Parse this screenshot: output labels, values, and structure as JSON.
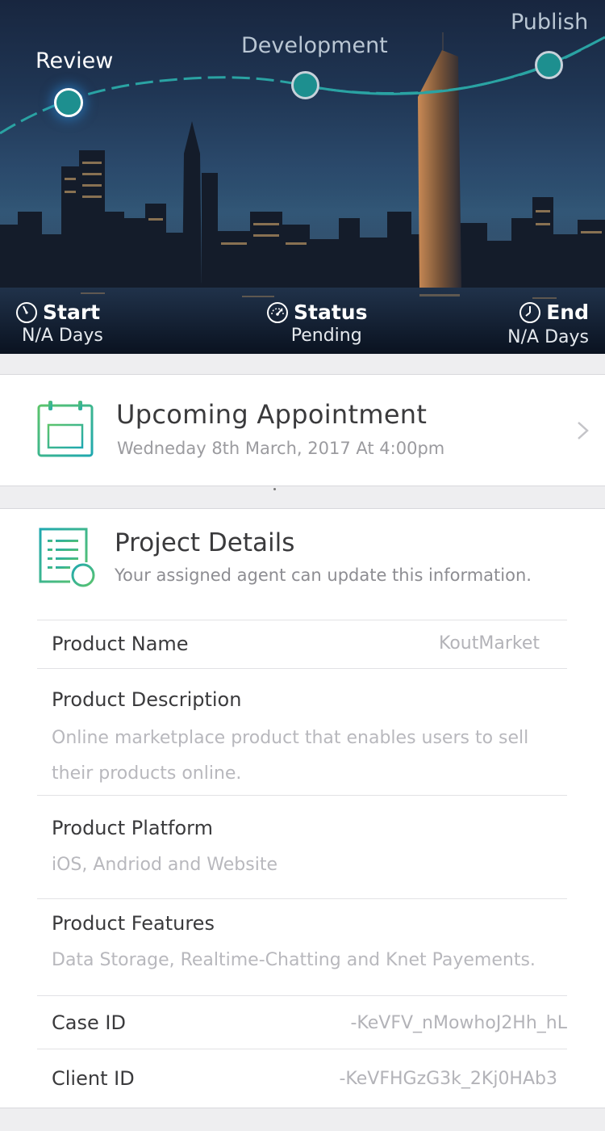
{
  "progress": {
    "stages": [
      {
        "label": "Review",
        "state": "current"
      },
      {
        "label": "Development",
        "state": "upcoming"
      },
      {
        "label": "Publish",
        "state": "upcoming"
      }
    ],
    "colors": {
      "node_fill": "#1d8f8f",
      "current_outline": "#ffffff",
      "path": "#2aa3a3"
    }
  },
  "hero_stats": {
    "start": {
      "label": "Start",
      "value": "N/A Days",
      "icon": "stopwatch-icon"
    },
    "status": {
      "label": "Status",
      "value": "Pending",
      "icon": "speedometer-icon"
    },
    "end": {
      "label": "End",
      "value": "N/A Days",
      "icon": "clock-icon"
    }
  },
  "appointment": {
    "title": "Upcoming Appointment",
    "date": "Wedneday 8th March, 2017 At 4:00pm",
    "icon": "calendar-icon"
  },
  "project_details": {
    "title": "Project Details",
    "subtitle": "Your assigned agent can update this information.",
    "icon": "document-add-icon",
    "fields": {
      "product_name": {
        "label": "Product Name",
        "value": "KoutMarket"
      },
      "product_description": {
        "label": "Product Description",
        "value": "Online marketplace product that enables users to sell their products online."
      },
      "product_platform": {
        "label": "Product Platform",
        "value": "iOS, Andriod and Website"
      },
      "product_features": {
        "label": "Product Features",
        "value": "Data Storage, Realtime-Chatting and Knet Payements."
      },
      "case_id": {
        "label": "Case ID",
        "value": "-KeVFV_nMowhoJ2Hh_hL"
      },
      "client_id": {
        "label": "Client ID",
        "value": "-KeVFHGzG3k_2Kj0HAb3"
      }
    }
  },
  "accent_colors": {
    "teal": "#2bb5a0",
    "green": "#5cc46b"
  }
}
